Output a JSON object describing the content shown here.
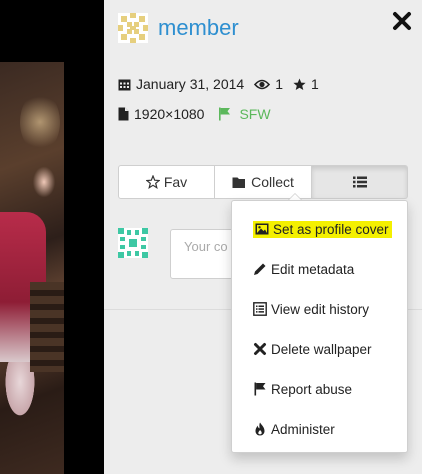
{
  "profile": {
    "username": "member"
  },
  "wallpaper": {
    "date": "January 31, 2014",
    "views": "1",
    "favorites": "1",
    "resolution": "1920×1080",
    "purity": "SFW",
    "purity_color": "#5cb85c"
  },
  "actions": {
    "fav_label": "Fav",
    "collect_label": "Collect"
  },
  "comment": {
    "placeholder": "Your co"
  },
  "menu": {
    "items": [
      {
        "label": "Set as profile cover",
        "icon": "image-icon",
        "highlighted": true
      },
      {
        "label": "Edit metadata",
        "icon": "pencil-icon"
      },
      {
        "label": "View edit history",
        "icon": "list-alt-icon"
      },
      {
        "label": "Delete wallpaper",
        "icon": "x-icon"
      },
      {
        "label": "Report abuse",
        "icon": "flag-icon"
      },
      {
        "label": "Administer",
        "icon": "fire-icon"
      }
    ]
  },
  "colors": {
    "accent": "#2e8fd0",
    "highlight": "#f4f000"
  }
}
